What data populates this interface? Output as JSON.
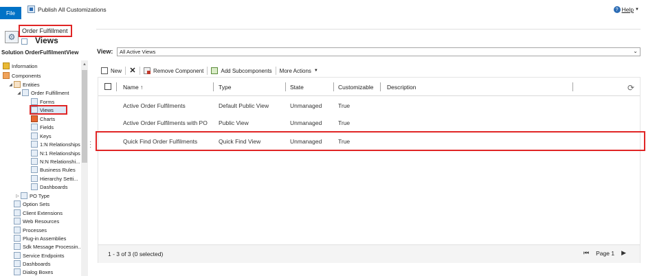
{
  "topbar": {
    "file_label": "File",
    "publish_label": "Publish All Customizations",
    "help_label": "Help"
  },
  "header": {
    "entity_name": "Order Fulfillment",
    "section_title": "Views",
    "solution_label": "Solution OrderFulfilmentView"
  },
  "sidebar": {
    "items": [
      {
        "label": "Information",
        "icon": "info-icon"
      },
      {
        "label": "Components",
        "icon": "components-icon"
      },
      {
        "label": "Entities",
        "icon": "entities-icon"
      },
      {
        "label": "Order Fulfillment",
        "icon": "entity-icon"
      },
      {
        "label": "Forms",
        "icon": "forms-icon"
      },
      {
        "label": "Views",
        "icon": "views-icon"
      },
      {
        "label": "Charts",
        "icon": "charts-icon"
      },
      {
        "label": "Fields",
        "icon": "fields-icon"
      },
      {
        "label": "Keys",
        "icon": "keys-icon"
      },
      {
        "label": "1:N Relationships",
        "icon": "relationship-icon"
      },
      {
        "label": "N:1 Relationships",
        "icon": "relationship-icon"
      },
      {
        "label": "N:N Relationshi...",
        "icon": "relationship-icon"
      },
      {
        "label": "Business Rules",
        "icon": "business-rules-icon"
      },
      {
        "label": "Hierarchy Setti...",
        "icon": "hierarchy-icon"
      },
      {
        "label": "Dashboards",
        "icon": "dashboards-icon"
      },
      {
        "label": "PO Type",
        "icon": "entity-icon"
      },
      {
        "label": "Option Sets",
        "icon": "option-sets-icon"
      },
      {
        "label": "Client Extensions",
        "icon": "client-extensions-icon"
      },
      {
        "label": "Web Resources",
        "icon": "web-resources-icon"
      },
      {
        "label": "Processes",
        "icon": "processes-icon"
      },
      {
        "label": "Plug-in Assemblies",
        "icon": "plugin-icon"
      },
      {
        "label": "Sdk Message Processin...",
        "icon": "sdk-message-icon"
      },
      {
        "label": "Service Endpoints",
        "icon": "service-endpoints-icon"
      },
      {
        "label": "Dashboards",
        "icon": "dashboards-icon"
      },
      {
        "label": "Dialog Boxes",
        "icon": "dialog-icon"
      }
    ]
  },
  "view_selector": {
    "label": "View:",
    "value": "All Active Views"
  },
  "toolbar": {
    "new_label": "New",
    "remove_label": "Remove Component",
    "add_sub_label": "Add Subcomponents",
    "more_label": "More Actions"
  },
  "grid": {
    "columns": [
      "Name ↑",
      "Type",
      "State",
      "Customizable",
      "Description"
    ],
    "rows": [
      {
        "name": "Active Order Fulfilments",
        "type": "Default Public View",
        "state": "Unmanaged",
        "customizable": "True"
      },
      {
        "name": "Active Order Fulfilments with PO",
        "type": "Public View",
        "state": "Unmanaged",
        "customizable": "True"
      },
      {
        "name": "Quick Find Order Fulfilments",
        "type": "Quick Find View",
        "state": "Unmanaged",
        "customizable": "True"
      }
    ],
    "footer_count": "1 - 3 of 3 (0 selected)",
    "page_label": "Page 1"
  },
  "colors": {
    "accent": "#0072c6",
    "highlight": "#e02424"
  }
}
